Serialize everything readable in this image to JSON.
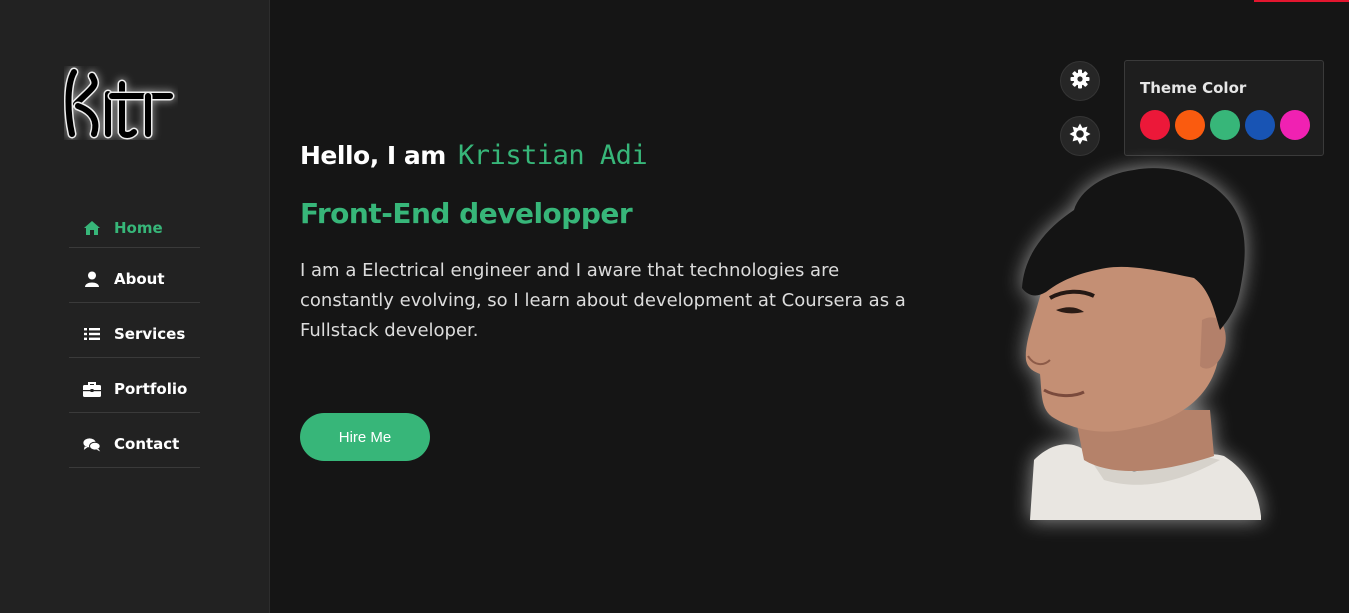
{
  "sidebar": {
    "logo_text": "kit",
    "items": [
      {
        "label": "Home",
        "icon": "home-icon",
        "active": true
      },
      {
        "label": "About",
        "icon": "user-icon",
        "active": false
      },
      {
        "label": "Services",
        "icon": "list-icon",
        "active": false
      },
      {
        "label": "Portfolio",
        "icon": "briefcase-icon",
        "active": false
      },
      {
        "label": "Contact",
        "icon": "comments-icon",
        "active": false
      }
    ]
  },
  "hero": {
    "greeting": "Hello, I am",
    "name": "Kristian Adi",
    "role": "Front-End developper",
    "bio": "I am a Electrical engineer and I aware that technologies are constantly evolving, so I learn about development at Coursera as a Fullstack developer.",
    "hire_label": "Hire Me"
  },
  "switcher": {
    "title": "Theme Color",
    "colors": [
      "#ec1839",
      "#fa5b0f",
      "#37b679",
      "#1854b4",
      "#f021b2"
    ]
  },
  "colors": {
    "accent": "#37b679",
    "background": "#151515",
    "sidebar": "#222222"
  }
}
